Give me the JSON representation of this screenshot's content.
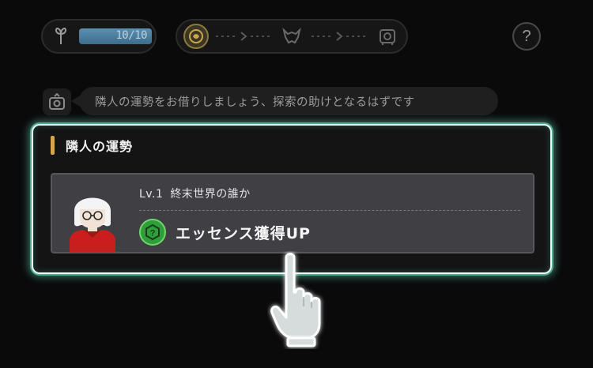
{
  "hud": {
    "stamina": {
      "value_text": "10/10",
      "fraction": 1.0,
      "icon": "leaf-icon"
    },
    "route": {
      "nodes": [
        "compass-icon",
        "beast-icon",
        "vault-icon"
      ],
      "current_index": 0
    },
    "help": {
      "label": "?"
    }
  },
  "hint": {
    "icon": "camera-tag-icon",
    "text": "隣人の運勢をお借りしましょう、探索の助けとなるはずです"
  },
  "panel": {
    "title": "隣人の運勢",
    "card": {
      "level": "Lv.1",
      "name": "終末世界の誰か",
      "effect_icon": "help-hexagon-icon",
      "effect_text": "エッセンス獲得UP"
    }
  },
  "tutorial": {
    "pointer_icon": "pointing-hand-icon"
  },
  "colors": {
    "background": "#0a0a0b",
    "panel_glow": "#6ff0c8",
    "title_accent": "#d8a64a",
    "effect_green": "#2f9e3a",
    "avatar_shirt": "#c81e1e"
  }
}
